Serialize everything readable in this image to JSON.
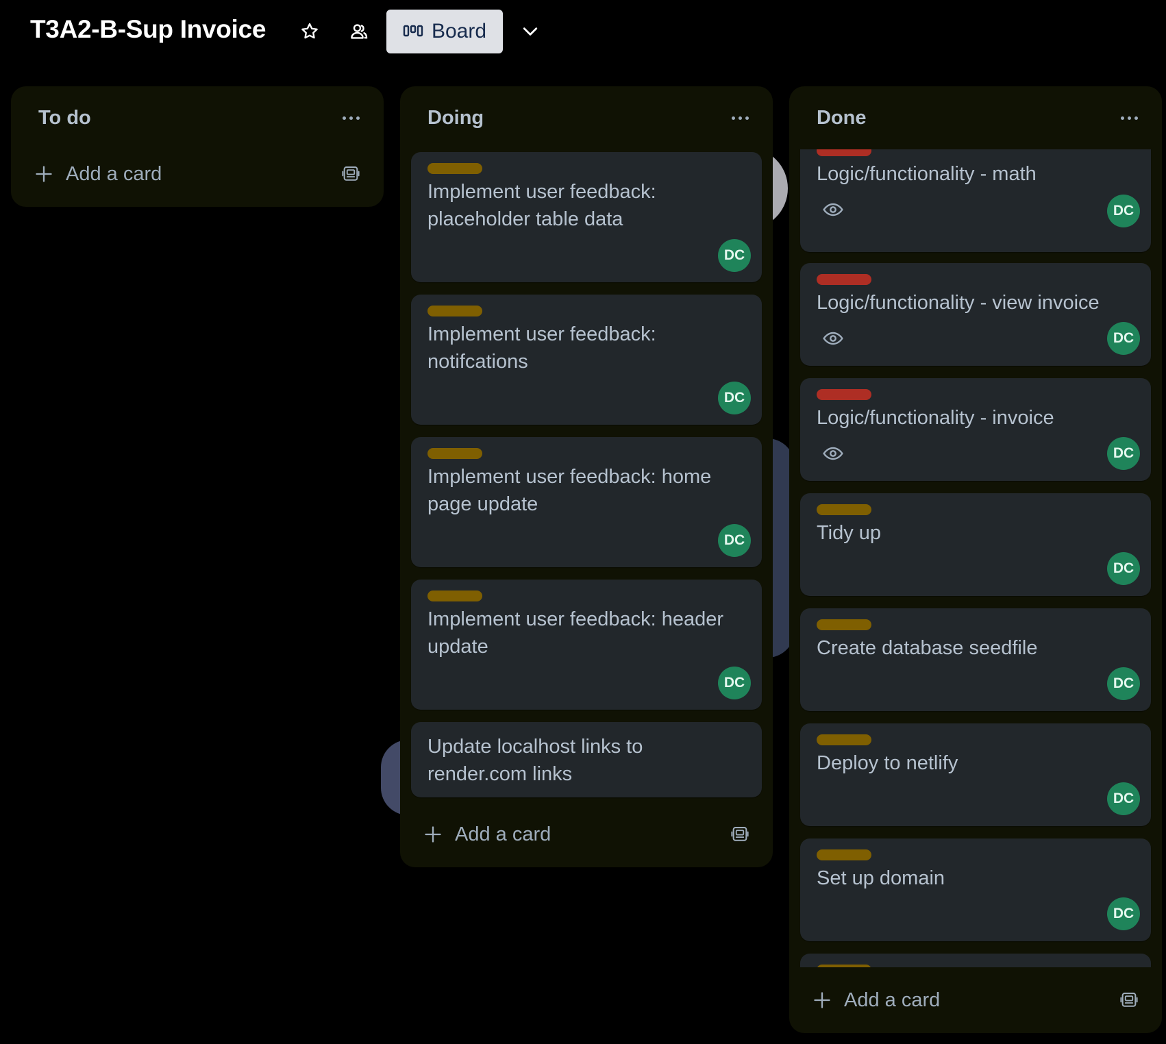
{
  "board": {
    "title": "T3A2-B-Sup Invoice",
    "view_label": "Board"
  },
  "lists": {
    "todo": {
      "title": "To do",
      "add_card_label": "Add a card"
    },
    "doing": {
      "title": "Doing",
      "add_card_label": "Add a card",
      "cards": [
        {
          "title": "Implement user feedback: placeholder table data",
          "label_color": "#7f5f01",
          "member": "DC"
        },
        {
          "title": "Implement user feedback: notifcations",
          "label_color": "#7f5f01",
          "member": "DC"
        },
        {
          "title": "Implement user feedback: home page update",
          "label_color": "#7f5f01",
          "member": "DC"
        },
        {
          "title": "Implement user feedback: header update",
          "label_color": "#7f5f01",
          "member": "DC"
        },
        {
          "title": "Update localhost links to render.com links"
        }
      ]
    },
    "done": {
      "title": "Done",
      "add_card_label": "Add a card",
      "cards": [
        {
          "title": "Logic/functionality - math",
          "label_color": "#ae2e24",
          "member": "DC",
          "watching": true
        },
        {
          "title": "Logic/functionality - view invoice",
          "label_color": "#ae2e24",
          "member": "DC",
          "watching": true
        },
        {
          "title": "Logic/functionality - invoice",
          "label_color": "#ae2e24",
          "member": "DC",
          "watching": true
        },
        {
          "title": "Tidy up",
          "label_color": "#7f5f01",
          "member": "DC"
        },
        {
          "title": "Create database seedfile",
          "label_color": "#7f5f01",
          "member": "DC"
        },
        {
          "title": "Deploy to netlify",
          "label_color": "#7f5f01",
          "member": "DC"
        },
        {
          "title": "Set up domain",
          "label_color": "#7f5f01",
          "member": "DC"
        },
        {
          "label_color": "#7f5f01"
        }
      ]
    }
  },
  "icons": {
    "star": "star-icon",
    "members": "members-icon",
    "board": "board-icon",
    "chevron": "chevron-down-icon",
    "menu": "more-icon",
    "add": "plus-icon",
    "template": "card-template-icon",
    "watch": "eye-icon"
  },
  "colors": {
    "list_bg": "#101204",
    "card_bg": "#22272b",
    "avatar_bg": "#1f845a",
    "label_yellow": "#7f5f01",
    "label_red": "#ae2e24"
  }
}
